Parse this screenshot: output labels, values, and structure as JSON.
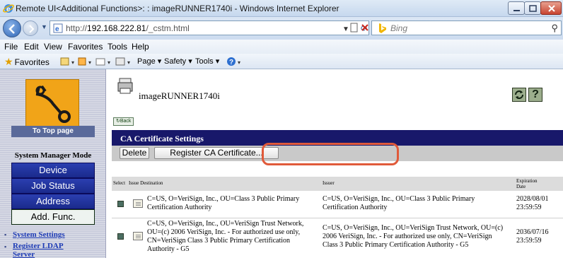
{
  "window": {
    "title": "Remote UI<Additional Functions>: : imageRUNNER1740i - Windows Internet Explorer"
  },
  "address_bar": {
    "url_prefix": "http://",
    "url_host": "192.168.222.81",
    "url_path": "/_cstm.html",
    "search_placeholder": "Bing"
  },
  "menu": [
    "File",
    "Edit",
    "View",
    "Favorites",
    "Tools",
    "Help"
  ],
  "favorites_bar": {
    "favorites_label": "Favorites",
    "page_label": "Page ▾",
    "safety_label": "Safety ▾",
    "tools_label": "Tools ▾"
  },
  "sidebar": {
    "to_top_label": "To Top page",
    "mode_label": "System Manager Mode",
    "buttons": [
      "Device",
      "Job Status",
      "Address",
      "Add. Func."
    ],
    "links": [
      "System Settings",
      "Register LDAP Server"
    ]
  },
  "main": {
    "device_name": "imageRUNNER1740i",
    "back_label": "Back",
    "help_label": "?",
    "panel_title": "CA Certificate Settings",
    "delete_label": "Delete",
    "register_label": "Register CA Certificate..."
  },
  "table": {
    "headers": {
      "select": "Select",
      "issue_destination": "Issue Destination",
      "issuer": "Issuer",
      "expiration_line1": "Expiration",
      "expiration_line2": "Date"
    },
    "rows": [
      {
        "destination_lines": [
          "C=US, O=VeriSign, Inc., OU=Class 3 Public Primary",
          "Certification Authority"
        ],
        "issuer_lines": [
          "C=US, O=VeriSign, Inc., OU=Class 3 Public Primary",
          "Certification Authority"
        ],
        "expiry_date": "2028/08/01",
        "expiry_time": "23:59:59"
      },
      {
        "destination_lines": [
          "C=US, O=VeriSign, Inc., OU=VeriSign Trust Network,",
          "OU=(c) 2006 VeriSign, Inc. - For authorized use only,",
          "CN=VeriSign Class 3 Public Primary Certification",
          "Authority - G5"
        ],
        "issuer_lines": [
          "C=US, O=VeriSign, Inc., OU=VeriSign Trust Network, OU=(c)",
          "2006 VeriSign, Inc. - For authorized use only, CN=VeriSign",
          "Class 3 Public Primary Certification Authority - G5"
        ],
        "expiry_date": "2036/07/16",
        "expiry_time": "23:59:59"
      }
    ]
  }
}
